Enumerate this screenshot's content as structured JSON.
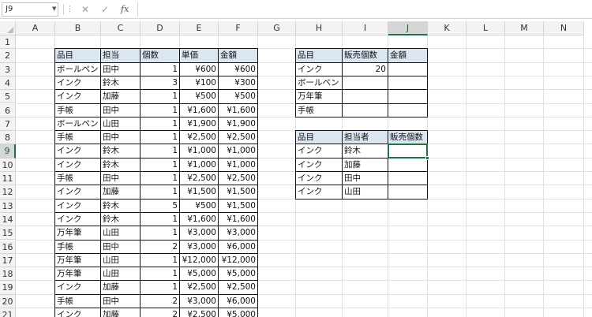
{
  "formula_bar": {
    "name_box": "J9",
    "cancel_icon": "✕",
    "enter_icon": "✓",
    "fx_label": "fx",
    "formula": ""
  },
  "sheet": {
    "columns": [
      "A",
      "B",
      "C",
      "D",
      "E",
      "F",
      "G",
      "H",
      "I",
      "J",
      "K",
      "L",
      "M",
      "N"
    ],
    "rows": [
      "1",
      "2",
      "3",
      "4",
      "5",
      "6",
      "7",
      "8",
      "9",
      "10",
      "11",
      "12",
      "13",
      "14",
      "15",
      "16",
      "17",
      "18",
      "19",
      "20",
      "21"
    ],
    "selected_column": "J",
    "selected_row": "9"
  },
  "sales_table": {
    "headers": [
      "品目",
      "担当",
      "個数",
      "単価",
      "金額"
    ],
    "rows": [
      [
        "ボールペン",
        "田中",
        "1",
        "¥600",
        "¥600"
      ],
      [
        "インク",
        "鈴木",
        "3",
        "¥100",
        "¥300"
      ],
      [
        "インク",
        "加藤",
        "1",
        "¥500",
        "¥500"
      ],
      [
        "手帳",
        "田中",
        "1",
        "¥1,600",
        "¥1,600"
      ],
      [
        "ボールペン",
        "山田",
        "1",
        "¥1,900",
        "¥1,900"
      ],
      [
        "手帳",
        "田中",
        "1",
        "¥2,500",
        "¥2,500"
      ],
      [
        "インク",
        "鈴木",
        "1",
        "¥1,000",
        "¥1,000"
      ],
      [
        "インク",
        "鈴木",
        "1",
        "¥1,000",
        "¥1,000"
      ],
      [
        "手帳",
        "田中",
        "1",
        "¥2,500",
        "¥2,500"
      ],
      [
        "インク",
        "加藤",
        "1",
        "¥1,500",
        "¥1,500"
      ],
      [
        "インク",
        "鈴木",
        "5",
        "¥500",
        "¥1,500"
      ],
      [
        "インク",
        "鈴木",
        "1",
        "¥1,600",
        "¥1,600"
      ],
      [
        "万年筆",
        "山田",
        "1",
        "¥3,000",
        "¥3,000"
      ],
      [
        "手帳",
        "田中",
        "2",
        "¥3,000",
        "¥6,000"
      ],
      [
        "万年筆",
        "山田",
        "1",
        "¥12,000",
        "¥12,000"
      ],
      [
        "万年筆",
        "山田",
        "1",
        "¥5,000",
        "¥5,000"
      ],
      [
        "インク",
        "加藤",
        "1",
        "¥2,500",
        "¥2,500"
      ],
      [
        "手帳",
        "田中",
        "2",
        "¥3,000",
        "¥6,000"
      ],
      [
        "インク",
        "加藤",
        "2",
        "¥2,500",
        "¥5,000"
      ]
    ]
  },
  "summary_table": {
    "headers": [
      "品目",
      "販売個数",
      "金額"
    ],
    "rows": [
      [
        "インク",
        "20",
        ""
      ],
      [
        "ボールペン",
        "",
        ""
      ],
      [
        "万年筆",
        "",
        ""
      ],
      [
        "手帳",
        "",
        ""
      ]
    ]
  },
  "person_table": {
    "headers": [
      "品目",
      "担当者",
      "販売個数"
    ],
    "rows": [
      [
        "インク",
        "鈴木",
        ""
      ],
      [
        "インク",
        "加藤",
        ""
      ],
      [
        "インク",
        "田中",
        ""
      ],
      [
        "インク",
        "山田",
        ""
      ]
    ]
  }
}
